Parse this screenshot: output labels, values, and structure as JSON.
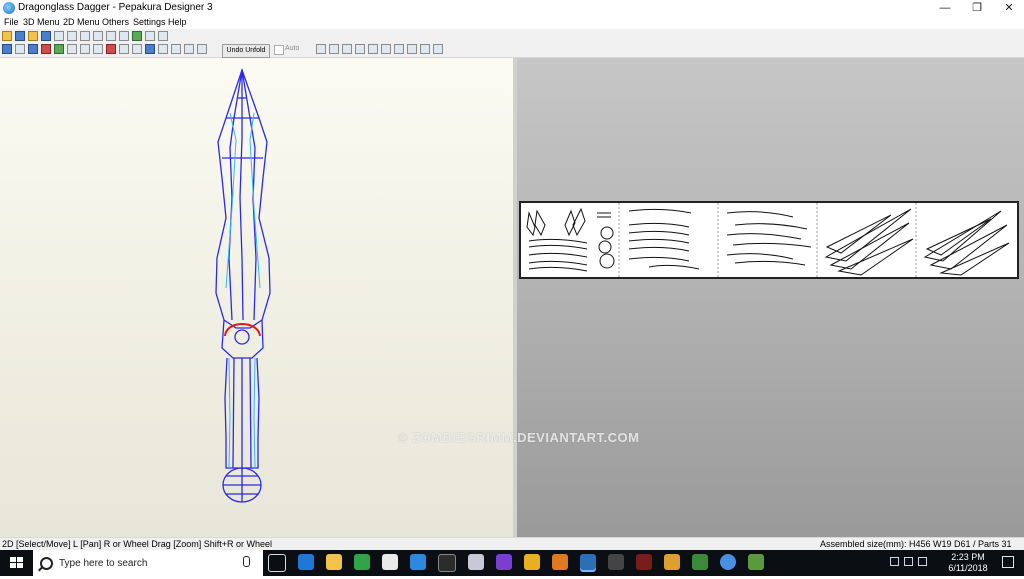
{
  "window": {
    "title": "Dragonglass Dagger - Pepakura Designer 3"
  },
  "window_controls": {
    "minimize": "—",
    "restore": "❐",
    "close": "✕"
  },
  "menu": [
    "File",
    "3D Menu",
    "2D Menu",
    "Others",
    "Settings",
    "Help"
  ],
  "toolbar": {
    "undo_unfold": "Undo Unfold",
    "auto": "Auto"
  },
  "watermark": "© ZOMBIEGRIMM.DEVIANTART.COM",
  "status": {
    "left": "2D [Select/Move] L [Pan] R or Wheel Drag [Zoom] Shift+R or Wheel",
    "right": "Assembled size(mm): H456 W19 D61 / Parts 31"
  },
  "taskbar": {
    "search_placeholder": "Type here to search",
    "time": "2:23 PM",
    "date": "6/11/2018"
  },
  "colors": {
    "wire_blue": "#2a2ae6",
    "wire_cyan": "#31b9ff",
    "wire_red": "#e01818",
    "sheet_border": "#222222"
  }
}
